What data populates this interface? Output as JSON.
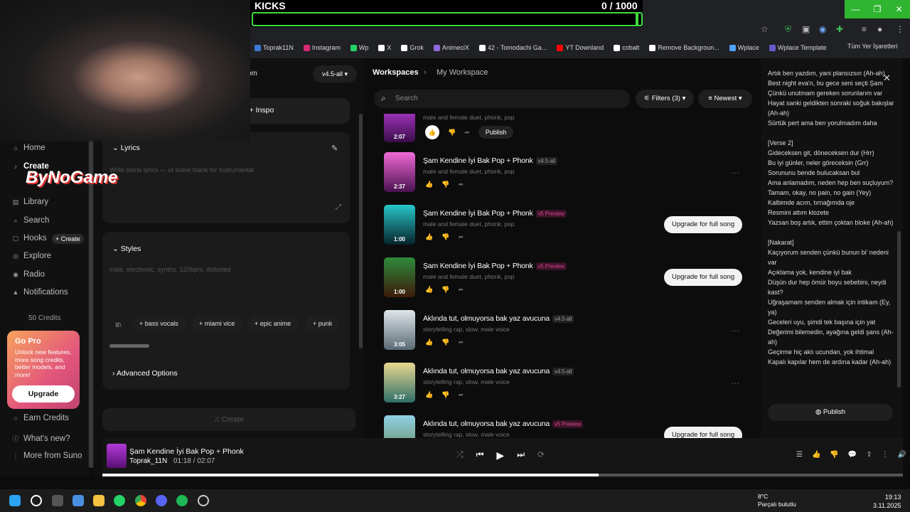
{
  "overlay": {
    "title": "KICKS",
    "count": "0 / 1000",
    "watermark": "ByNoGame"
  },
  "browser": {
    "bookmarks": [
      "Toprak11N",
      "Instagram",
      "Wp",
      "X",
      "Grok",
      "AnimeciX",
      "42 - Tomodachi Ga...",
      "YT Downland",
      "cobalt",
      "Remove Backgroun...",
      "Wplace",
      "Wplace Template"
    ],
    "bookmark_colors": [
      "#3c7bd6",
      "#d62976",
      "#25d366",
      "#ffffff",
      "#ffffff",
      "#8d6bd8",
      "#ffffff",
      "#ff0000",
      "#ffffff",
      "#ffffff",
      "#4fa3ff",
      "#6a5acd"
    ],
    "all_bookmarks": "Tüm Yer İşaretleri"
  },
  "sidebar": {
    "home": "Home",
    "create": "Create",
    "library": "Library",
    "search": "Search",
    "hooks": "Hooks",
    "hooks_create": "+ Create",
    "explore": "Explore",
    "radio": "Radio",
    "notifications": "Notifications",
    "credits": "50 Credits",
    "gopro": {
      "title": "Go Pro",
      "desc": "Unlock new features, more song credits, better models, and more!",
      "button": "Upgrade"
    },
    "earn": "Earn Credits",
    "whats_new": "What's new?",
    "more_from": "More from Suno"
  },
  "create_panel": {
    "custom_tab": "om",
    "model": "v4.5-all",
    "inspo": "+ Inspo",
    "lyrics_label": "Lyrics",
    "lyrics_placeholder": "Write some lyrics — or leave blank for instrumental",
    "styles_label": "Styles",
    "styles_placeholder": "indie, electronic, synths, 120bpm, distorted",
    "chips": [
      "+ bass vocals",
      "+ miami vice",
      "+ epic anime",
      "+ punk"
    ],
    "advanced": "Advanced Options",
    "create_button": "Create"
  },
  "feed": {
    "breadcrumb_root": "Workspaces",
    "breadcrumb_current": "My Workspace",
    "search_placeholder": "Search",
    "filters": "Filters (3)",
    "sort": "Newest",
    "publish": "Publish",
    "upgrade": "Upgrade for full song",
    "songs": [
      {
        "title": "",
        "tag": "",
        "tag_style": "",
        "sub": "male and female duet, phonk, pop",
        "dur": "2:07",
        "upgrade": false
      },
      {
        "title": "Şam Kendine İyi Bak Pop + Phonk",
        "tag": "v4.5-all",
        "tag_style": "tg1",
        "sub": "male and female duet, phonk, pop",
        "dur": "2:37",
        "upgrade": false
      },
      {
        "title": "Şam Kendine İyi Bak Pop + Phonk",
        "tag": "v5 Preview",
        "tag_style": "tg2",
        "sub": "male and female duet, phonk, pop",
        "dur": "1:00",
        "upgrade": true
      },
      {
        "title": "Şam Kendine İyi Bak Pop + Phonk",
        "tag": "v5 Preview",
        "tag_style": "tg2",
        "sub": "male and female duet, phonk, pop",
        "dur": "1:00",
        "upgrade": true
      },
      {
        "title": "Aklında tut, olmuyorsa bak yaz avucuna",
        "tag": "v4.5-all",
        "tag_style": "tg1",
        "sub": "storytelling rap, slow, male voice",
        "dur": "3:05",
        "upgrade": false
      },
      {
        "title": "Aklında tut, olmuyorsa bak yaz avucuna",
        "tag": "v4.5-all",
        "tag_style": "tg1",
        "sub": "storytelling rap, slow, male voice",
        "dur": "3:27",
        "upgrade": false
      },
      {
        "title": "Aklında tut, olmuyorsa bak yaz avucuna",
        "tag": "v5 Preview",
        "tag_style": "tg2",
        "sub": "storytelling rap, slow, male voice",
        "dur": "",
        "upgrade": true
      }
    ]
  },
  "lyrics_panel": {
    "text": "Artık ben yazdım, yani plansızsın (Ah-ah)\nBest night eva'n, bu gece seni seçti Şam\nÇünkü unutmam gereken sorunlarım var\nHayat sanki geldikten sonraki soğuk bakışlar (Ah-ah)\nSürtük pert ama ben yorulmadım daha\n\n[Verse 2]\nGideceksen git, döneceksen dur (Hrr)\nBu iyi günler, neler göreceksin (Grr)\nSorununu bende bulucaksan bul\nAma anlamadım, neden hep ben suçluyum?\nTamam, okay, no pain, no gain (Yey)\nKalbimde acım, tırnağımda oje\nResmini attım klozete\nYazsan boş artık, ettim çoktan bloke (Ah-ah)\n\n[Nakarat]\nKaçıyorum senden çünkü bunun bi' nedeni var\nAçıklama yok, kendine iyi bak\nDüşün dur hep ömür boyu sebebini, neydi kast?\nUğraşamam senden almak için intikam (Ey, ya)\nGeceleri uyu, şimdi tek başına için yat\nDeğerimi bilemedin, ayağına geldi şans (Ah-ah)\nGeçirme hiç aklı ucundan, yok ihtimal\nKapalı kapılar hem de ardına kadar (Ah-ah)",
    "publish": "Publish"
  },
  "player": {
    "title": "Şam Kendine İyi Bak Pop + Phonk",
    "artist": "Toprak_11N",
    "time": "01:18  /  02:07",
    "progress": 0.62
  },
  "taskbar": {
    "temp": "8°C",
    "weather": "Parçalı bulutlu",
    "time": "19:13",
    "date": "3.11.2025"
  }
}
